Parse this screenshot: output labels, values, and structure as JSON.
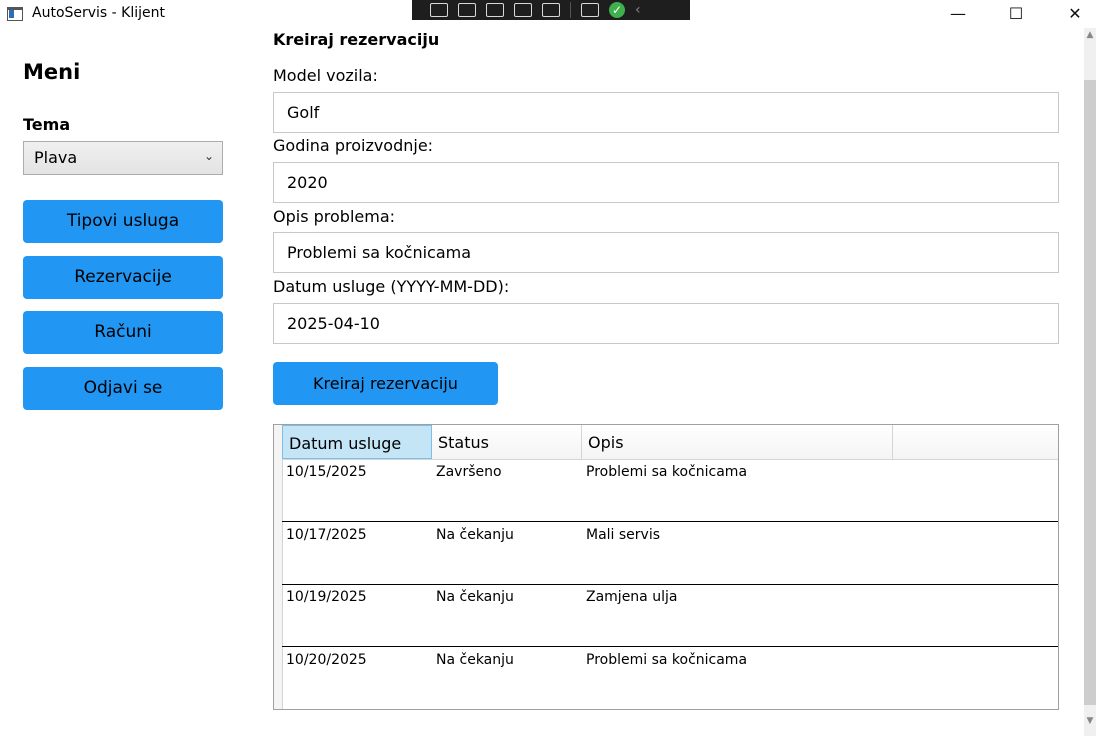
{
  "window": {
    "title": "AutoServis - Klijent",
    "minimize": "—",
    "maximize": "☐",
    "close": "✕"
  },
  "menu": {
    "title": "Meni",
    "theme_label": "Tema",
    "theme_value": "Plava",
    "buttons": [
      "Tipovi usluga",
      "Rezervacije",
      "Računi",
      "Odjavi se"
    ]
  },
  "form": {
    "heading": "Kreiraj rezervaciju",
    "model_label": "Model vozila:",
    "model_value": "Golf",
    "year_label": "Godina proizvodnje:",
    "year_value": "2020",
    "problem_label": "Opis problema:",
    "problem_value": "Problemi sa kočnicama",
    "date_label": "Datum usluge (YYYY-MM-DD):",
    "date_value": "2025-04-10",
    "submit_label": "Kreiraj rezervaciju"
  },
  "table": {
    "columns": [
      "Datum usluge",
      "Status",
      "Opis"
    ],
    "rows": [
      [
        "10/15/2025",
        "Završeno",
        "Problemi sa kočnicama"
      ],
      [
        "10/17/2025",
        "Na čekanju",
        "Mali servis"
      ],
      [
        "10/19/2025",
        "Na čekanju",
        "Zamjena ulja"
      ],
      [
        "10/20/2025",
        "Na čekanju",
        "Problemi sa kočnicama"
      ]
    ]
  },
  "colors": {
    "accent": "#2196f3",
    "header_selected": "#c4e5f6"
  }
}
